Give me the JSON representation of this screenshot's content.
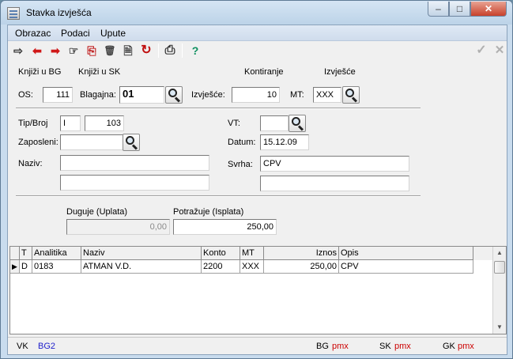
{
  "window": {
    "title": "Stavka izvješća",
    "min": "–",
    "max": "□",
    "close": "✕"
  },
  "menu": [
    "Obrazac",
    "Podaci",
    "Upute"
  ],
  "toolbar": {
    "enter": "⇨",
    "prev": "⬅",
    "next": "➡",
    "pointer": "☞",
    "copy": "⎘",
    "delete": "🗑",
    "find": "🗎",
    "refresh": "↻",
    "print": "⎙",
    "help": "?",
    "confirm": "✓",
    "cancel": "✕"
  },
  "header": {
    "knjizi_bg": "Knjiži u BG",
    "knjizi_sk": "Knjiži u SK",
    "kontiranje": "Kontiranje",
    "izvjesce": "Izvješće"
  },
  "row1": {
    "os_label": "OS:",
    "os_value": "111",
    "blagajna_label": "Blagajna:",
    "blagajna_value": "01",
    "izvjesce_label": "Izvješće:",
    "izvjesce_value": "10",
    "mt_label": "MT:",
    "mt_value": "XXX"
  },
  "form": {
    "tip_broj_label": "Tip/Broj",
    "tip_value": "I",
    "broj_value": "103",
    "zaposleni_label": "Zaposleni:",
    "zaposleni_value": "",
    "naziv_label": "Naziv:",
    "naziv_value1": "",
    "naziv_value2": "",
    "vt_label": "VT:",
    "vt_value": "",
    "datum_label": "Datum:",
    "datum_value": "15.12.09",
    "svrha_label": "Svrha:",
    "svrha_value1": "CPV",
    "svrha_value2": ""
  },
  "amounts": {
    "duguje_label": "Duguje (Uplata)",
    "duguje_value": "0,00",
    "potrazuje_label": "Potražuje (Isplata)",
    "potrazuje_value": "250,00"
  },
  "grid": {
    "columns": [
      "T",
      "Analitika",
      "Naziv",
      "Konto",
      "MT",
      "Iznos",
      "Opis"
    ],
    "rows": [
      {
        "marker": "▶",
        "t": "D",
        "analitika": "0183",
        "naziv": "ATMAN V.D.",
        "konto": "2200",
        "mt": "XXX",
        "iznos": "250,00",
        "opis": "CPV"
      }
    ]
  },
  "status": {
    "vk_label": "VK",
    "vk_value": "BG2",
    "bg_label": "BG",
    "bg_value": "pmx",
    "sk_label": "SK",
    "sk_value": "pmx",
    "gk_label": "GK",
    "gk_value": "pmx"
  }
}
